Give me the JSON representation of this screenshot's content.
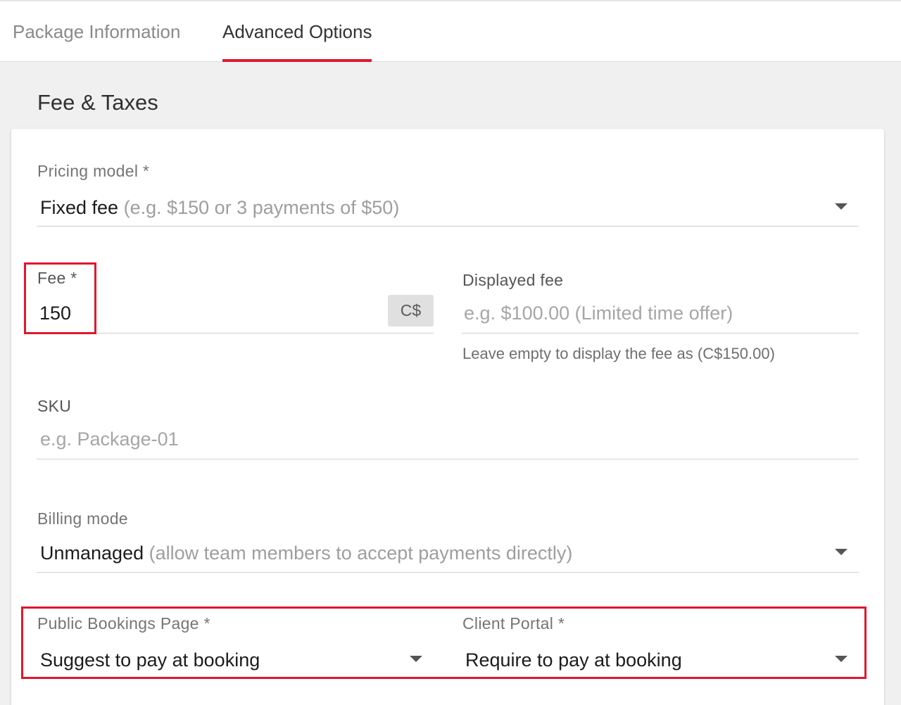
{
  "tabs": [
    {
      "label": "Package Information"
    },
    {
      "label": "Advanced Options"
    }
  ],
  "section_title": "Fee & Taxes",
  "pricing_model": {
    "label": "Pricing model *",
    "value": "Fixed fee",
    "hint": "(e.g. $150 or 3 payments of $50)"
  },
  "fee": {
    "label": "Fee *",
    "value": "150",
    "currency": "C$"
  },
  "displayed_fee": {
    "label": "Displayed fee",
    "placeholder": "e.g. $100.00 (Limited time offer)",
    "helper": "Leave empty to display the fee as (C$150.00)"
  },
  "sku": {
    "label": "SKU",
    "placeholder": "e.g. Package-01"
  },
  "billing_mode": {
    "label": "Billing mode",
    "value": "Unmanaged",
    "hint": "(allow team members to accept payments directly)"
  },
  "public_bookings": {
    "label": "Public Bookings Page *",
    "value": "Suggest to pay at booking"
  },
  "client_portal": {
    "label": "Client Portal *",
    "value": "Require to pay at booking"
  },
  "colors": {
    "accent": "#e0172f",
    "background": "#f0f0f0",
    "card": "#ffffff"
  }
}
